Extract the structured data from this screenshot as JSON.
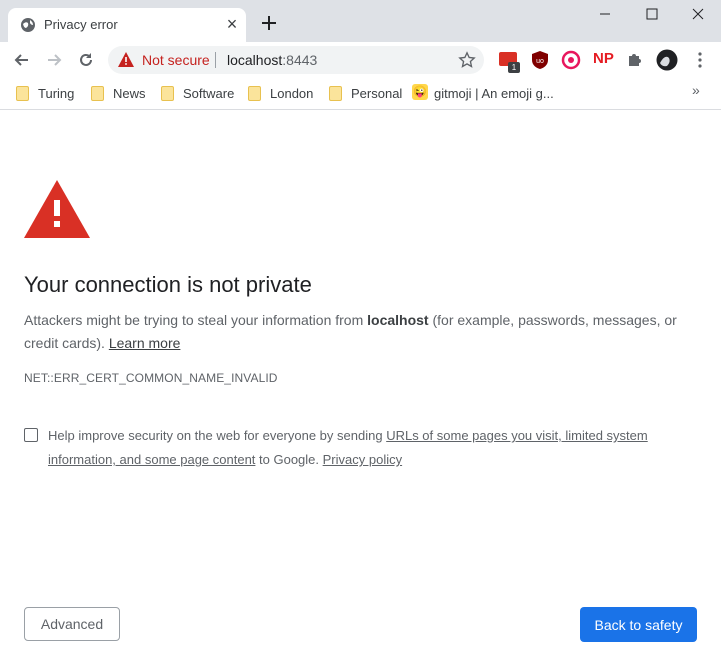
{
  "tab": {
    "title": "Privacy error",
    "close": "×"
  },
  "omnibox": {
    "security_label": "Not secure",
    "host": "localhost",
    "port": ":8443"
  },
  "extensions": {
    "np_label": "NP",
    "badge_count": "1"
  },
  "bookmarks": {
    "items": [
      {
        "label": "Turing"
      },
      {
        "label": "News"
      },
      {
        "label": "Software"
      },
      {
        "label": "London"
      },
      {
        "label": "Personal"
      },
      {
        "label": "gitmoji | An emoji g..."
      }
    ],
    "overflow": "»"
  },
  "interstitial": {
    "heading": "Your connection is not private",
    "body_prefix": "Attackers might be trying to steal your information from ",
    "body_host": "localhost",
    "body_suffix": " (for example, passwords, messages, or credit cards). ",
    "learn_more": "Learn more",
    "error_code": "NET::ERR_CERT_COMMON_NAME_INVALID",
    "optin_prefix": "Help improve security on the web for everyone by sending ",
    "optin_link": "URLs of some pages you visit, limited system information, and some page content",
    "optin_middle": " to Google. ",
    "privacy_policy": "Privacy policy",
    "checkbox_checked": false,
    "advanced_button": "Advanced",
    "back_button": "Back to safety"
  },
  "colors": {
    "accent": "#1a73e8",
    "warning_red": "#d93025",
    "not_secure_red": "#c5221f"
  }
}
